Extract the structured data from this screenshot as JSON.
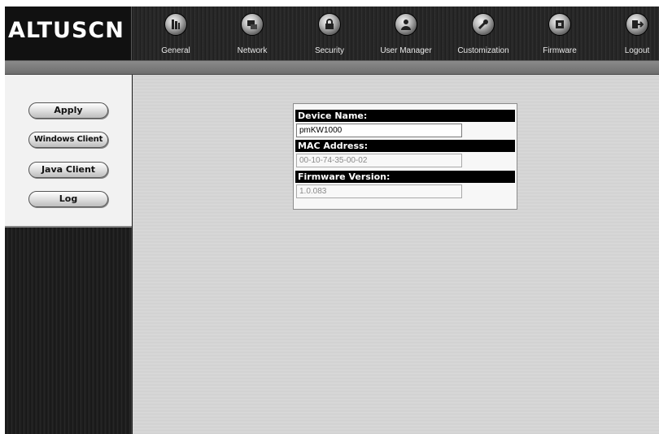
{
  "brand": {
    "logo_text": "ALTUSCN"
  },
  "nav": [
    {
      "label": "General",
      "icon": "general-icon"
    },
    {
      "label": "Network",
      "icon": "network-icon"
    },
    {
      "label": "Security",
      "icon": "security-icon"
    },
    {
      "label": "User Manager",
      "icon": "user-manager-icon"
    },
    {
      "label": "Customization",
      "icon": "customization-icon"
    },
    {
      "label": "Firmware",
      "icon": "firmware-icon"
    },
    {
      "label": "Logout",
      "icon": "logout-icon"
    }
  ],
  "sidebar": {
    "buttons": [
      {
        "label": "Apply"
      },
      {
        "label": "Windows Client"
      },
      {
        "label": "Java Client"
      },
      {
        "label": "Log"
      }
    ]
  },
  "info": {
    "device_name_label": "Device Name:",
    "device_name_value": "pmKW1000",
    "mac_label": "MAC Address:",
    "mac_value": "00-10-74-35-00-02",
    "firmware_label": "Firmware Version:",
    "firmware_value": "1.0.083"
  }
}
